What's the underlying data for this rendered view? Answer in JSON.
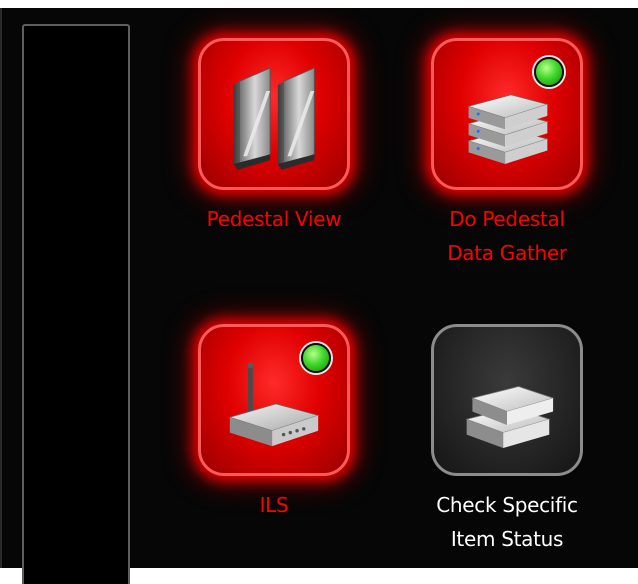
{
  "tiles": [
    {
      "label": "Pedestal View",
      "icon": "pedestal-gates-icon",
      "state": "active",
      "status": null
    },
    {
      "label": "Do Pedestal\nData Gather",
      "icon": "server-stack-icon",
      "state": "active",
      "status": "online"
    },
    {
      "label": "ILS",
      "icon": "router-icon",
      "state": "active",
      "status": "online"
    },
    {
      "label": "Check Specific\nItem Status",
      "icon": "books-icon",
      "state": "inactive",
      "status": null
    }
  ],
  "colors": {
    "active_label": "#ff0000",
    "inactive_label": "#ffffff",
    "active_tile": "#e00000",
    "status_led": "#3fd82a",
    "background": "#060606"
  }
}
